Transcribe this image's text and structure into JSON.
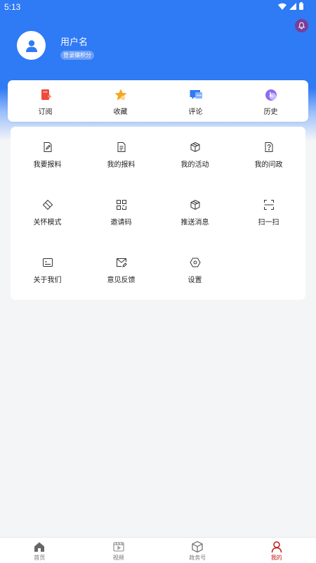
{
  "status_bar": {
    "time": "5:13"
  },
  "profile": {
    "username": "用户名",
    "points_badge": "登录赚积分"
  },
  "quick_actions": [
    {
      "label": "订阅",
      "icon": "subscribe-icon"
    },
    {
      "label": "收藏",
      "icon": "favorite-star-icon"
    },
    {
      "label": "评论",
      "icon": "comment-icon"
    },
    {
      "label": "历史",
      "icon": "history-icon"
    }
  ],
  "menu_items": [
    {
      "label": "我要报料",
      "icon": "edit-doc-icon"
    },
    {
      "label": "我的报料",
      "icon": "doc-list-icon"
    },
    {
      "label": "我的活动",
      "icon": "cube-icon"
    },
    {
      "label": "我的问政",
      "icon": "question-doc-icon"
    },
    {
      "label": "关怀模式",
      "icon": "care-diamond-icon"
    },
    {
      "label": "邀请码",
      "icon": "qr-grid-icon"
    },
    {
      "label": "推送消息",
      "icon": "push-cube-icon"
    },
    {
      "label": "扫一扫",
      "icon": "scan-icon"
    },
    {
      "label": "关于我们",
      "icon": "about-card-icon"
    },
    {
      "label": "意见反馈",
      "icon": "feedback-mail-icon"
    },
    {
      "label": "设置",
      "icon": "settings-hexagon-icon"
    }
  ],
  "tabbar": [
    {
      "label": "首页",
      "icon": "home-icon"
    },
    {
      "label": "视频",
      "icon": "video-icon"
    },
    {
      "label": "政务号",
      "icon": "gov-cube-icon"
    },
    {
      "label": "我的",
      "icon": "user-icon",
      "active": true
    }
  ],
  "colors": {
    "brand_blue": "#2f7af5",
    "active_red": "#c31b1b",
    "bell_purple": "#7a3e99"
  }
}
